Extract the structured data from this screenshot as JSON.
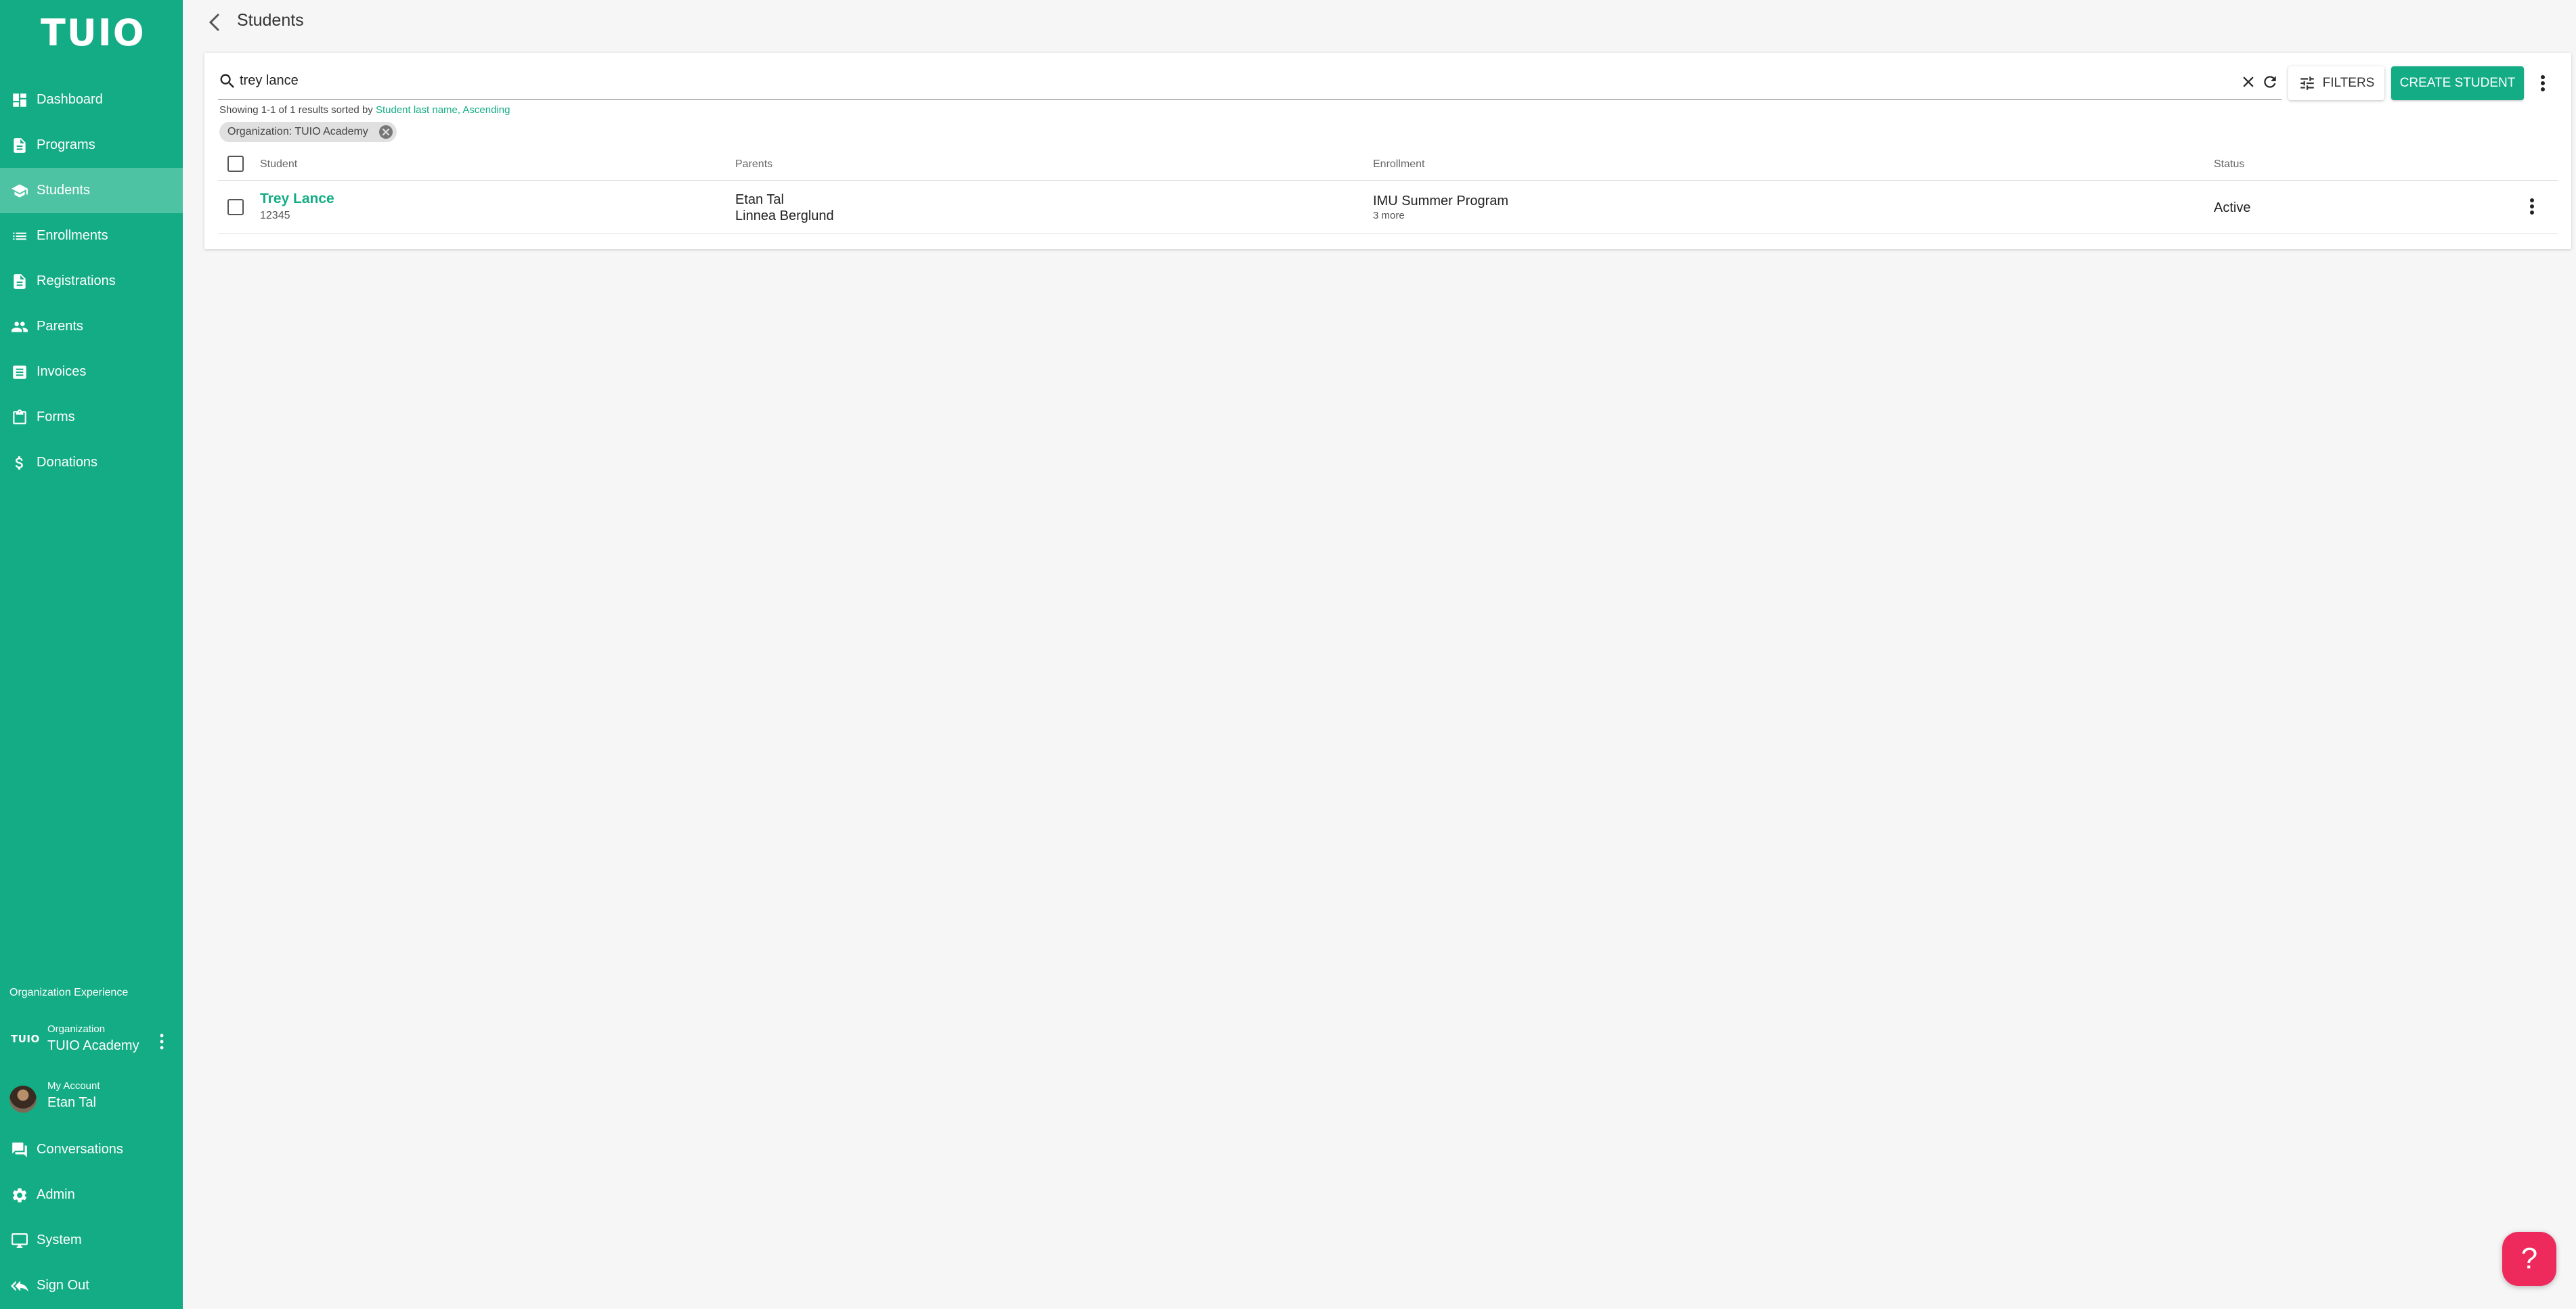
{
  "brand": {
    "logo_text": "TUIO"
  },
  "sidebar": {
    "items": [
      {
        "label": "Dashboard",
        "icon": "dashboard-icon"
      },
      {
        "label": "Programs",
        "icon": "document-icon"
      },
      {
        "label": "Students",
        "icon": "school-icon",
        "active": true
      },
      {
        "label": "Enrollments",
        "icon": "list-icon"
      },
      {
        "label": "Registrations",
        "icon": "document-icon"
      },
      {
        "label": "Parents",
        "icon": "people-icon"
      },
      {
        "label": "Invoices",
        "icon": "invoice-icon"
      },
      {
        "label": "Forms",
        "icon": "clipboard-icon"
      },
      {
        "label": "Donations",
        "icon": "dollar-icon"
      }
    ],
    "section_label": "Organization Experience",
    "organization": {
      "badge": "TUIO",
      "label": "Organization",
      "name": "TUIO Academy"
    },
    "account": {
      "label": "My Account",
      "name": "Etan Tal"
    },
    "bottom_items": [
      {
        "label": "Conversations",
        "icon": "chat-icon"
      },
      {
        "label": "Admin",
        "icon": "gear-icon"
      },
      {
        "label": "System",
        "icon": "monitor-icon"
      },
      {
        "label": "Sign Out",
        "icon": "sign-out-icon"
      }
    ]
  },
  "header": {
    "title": "Students"
  },
  "search": {
    "value": "trey lance",
    "placeholder": "Search"
  },
  "toolbar": {
    "filters_label": "FILTERS",
    "create_label": "CREATE STUDENT"
  },
  "results": {
    "prefix": "Showing 1-1 of 1 results sorted by ",
    "sort": "Student last name, Ascending"
  },
  "chip": {
    "label": "Organization: TUIO Academy"
  },
  "table": {
    "columns": [
      "Student",
      "Parents",
      "Enrollment",
      "Status"
    ],
    "rows": [
      {
        "student_name": "Trey Lance",
        "student_id": "12345",
        "parents": [
          "Etan Tal",
          "Linnea Berglund"
        ],
        "enrollment": "IMU Summer Program",
        "enrollment_more": "3 more",
        "status": "Active"
      }
    ]
  },
  "help": {
    "label": "?"
  },
  "colors": {
    "accent": "#13ac84",
    "active_item": "#4ec3a3",
    "help": "#ee2a5c"
  }
}
